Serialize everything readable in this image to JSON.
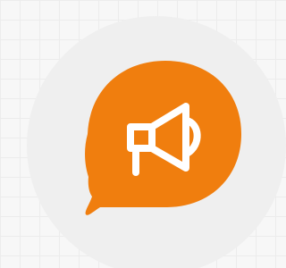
{
  "icon": {
    "name": "megaphone-icon",
    "description_role": "announcement-badge"
  },
  "colors": {
    "page_background": "#f7f7f7",
    "grid_lines": "#ececec",
    "circle_backdrop": "#efefef",
    "bubble_fill": "#f07e0e",
    "glyph_stroke": "#ffffff"
  }
}
